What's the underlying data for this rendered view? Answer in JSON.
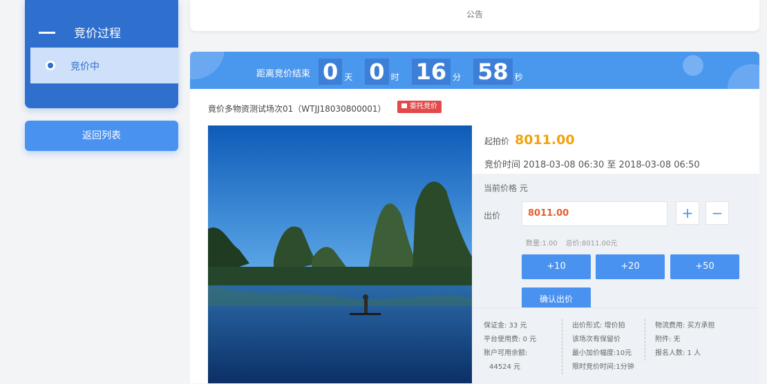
{
  "sidebar": {
    "section_title": "竞价过程",
    "active_item": "竞价中",
    "back_button": "返回列表"
  },
  "notice": {
    "title": "公告"
  },
  "countdown": {
    "label": "距离竞价结束",
    "days": "0",
    "days_unit": "天",
    "hours": "0",
    "hours_unit": "时",
    "minutes": "16",
    "minutes_unit": "分",
    "seconds": "58",
    "seconds_unit": "秒"
  },
  "item": {
    "title": "竟价多物资测试场次01（WTJJ18030800001）",
    "tag": "委托竞价",
    "start_label": "起拍价",
    "start_price": "8011.00",
    "time_text": "竞价时间 2018-03-08 06:30  至  2018-03-08 06:50"
  },
  "bid": {
    "current_price": "当前价格 元",
    "bid_label": "出价",
    "bid_value": "8011.00",
    "plus": "+",
    "minus": "−",
    "quantity": "数量:1.00",
    "total": "总价:8011.00元",
    "inc10": "+10",
    "inc20": "+20",
    "inc50": "+50",
    "confirm": "确认出价"
  },
  "fees": {
    "deposit": "保证金:  33  元",
    "platform_fee": "平台使用费:  0  元",
    "balance_label": "账户可用余额:",
    "balance_value": "44524  元",
    "bid_form": "出价形式: 增价拍",
    "reserve": "该场次有保留价",
    "min_increment": "最小加价幅度:10元",
    "time_limit": "限时竞价时间:1分钟",
    "logistics": "物流费用:  买方承担",
    "attachment": "附件: 无",
    "registrants": "报名人数:  1  人"
  },
  "colors": {
    "primary": "#4a92f0",
    "sidebar": "#2f6fcd",
    "price": "#f2a20a",
    "tag": "#e24a4a"
  }
}
